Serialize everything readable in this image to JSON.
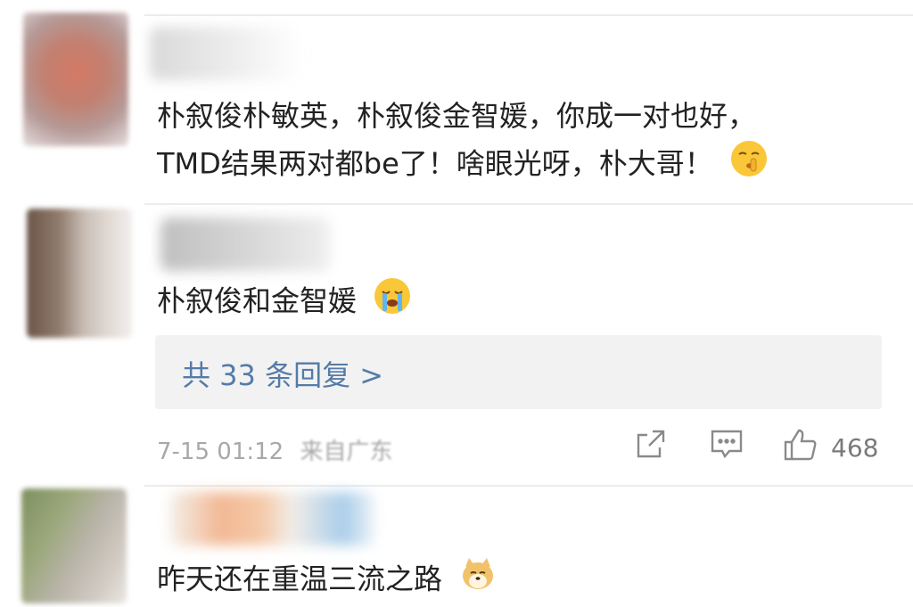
{
  "comments": [
    {
      "lines": [
        "朴叙俊朴敏英，朴叙俊金智媛，你成一对也好，",
        "TMD结果两对都be了！啥眼光呀，朴大哥！"
      ],
      "emoji": "shush-emoji"
    },
    {
      "lines": [
        "朴叙俊和金智媛"
      ],
      "emoji": "crying-emoji",
      "reply_link": "共 33 条回复 >",
      "timestamp": "7-15 01:12",
      "location": "来自广东",
      "likes": "468"
    },
    {
      "lines": [
        "昨天还在重温三流之路"
      ],
      "emoji": "doge-emoji"
    }
  ],
  "colors": {
    "link": "#557ba8",
    "meta": "#a8a8a8",
    "reply_bg": "#f2f2f2"
  },
  "icons": [
    "share-icon",
    "comment-icon",
    "like-icon"
  ]
}
